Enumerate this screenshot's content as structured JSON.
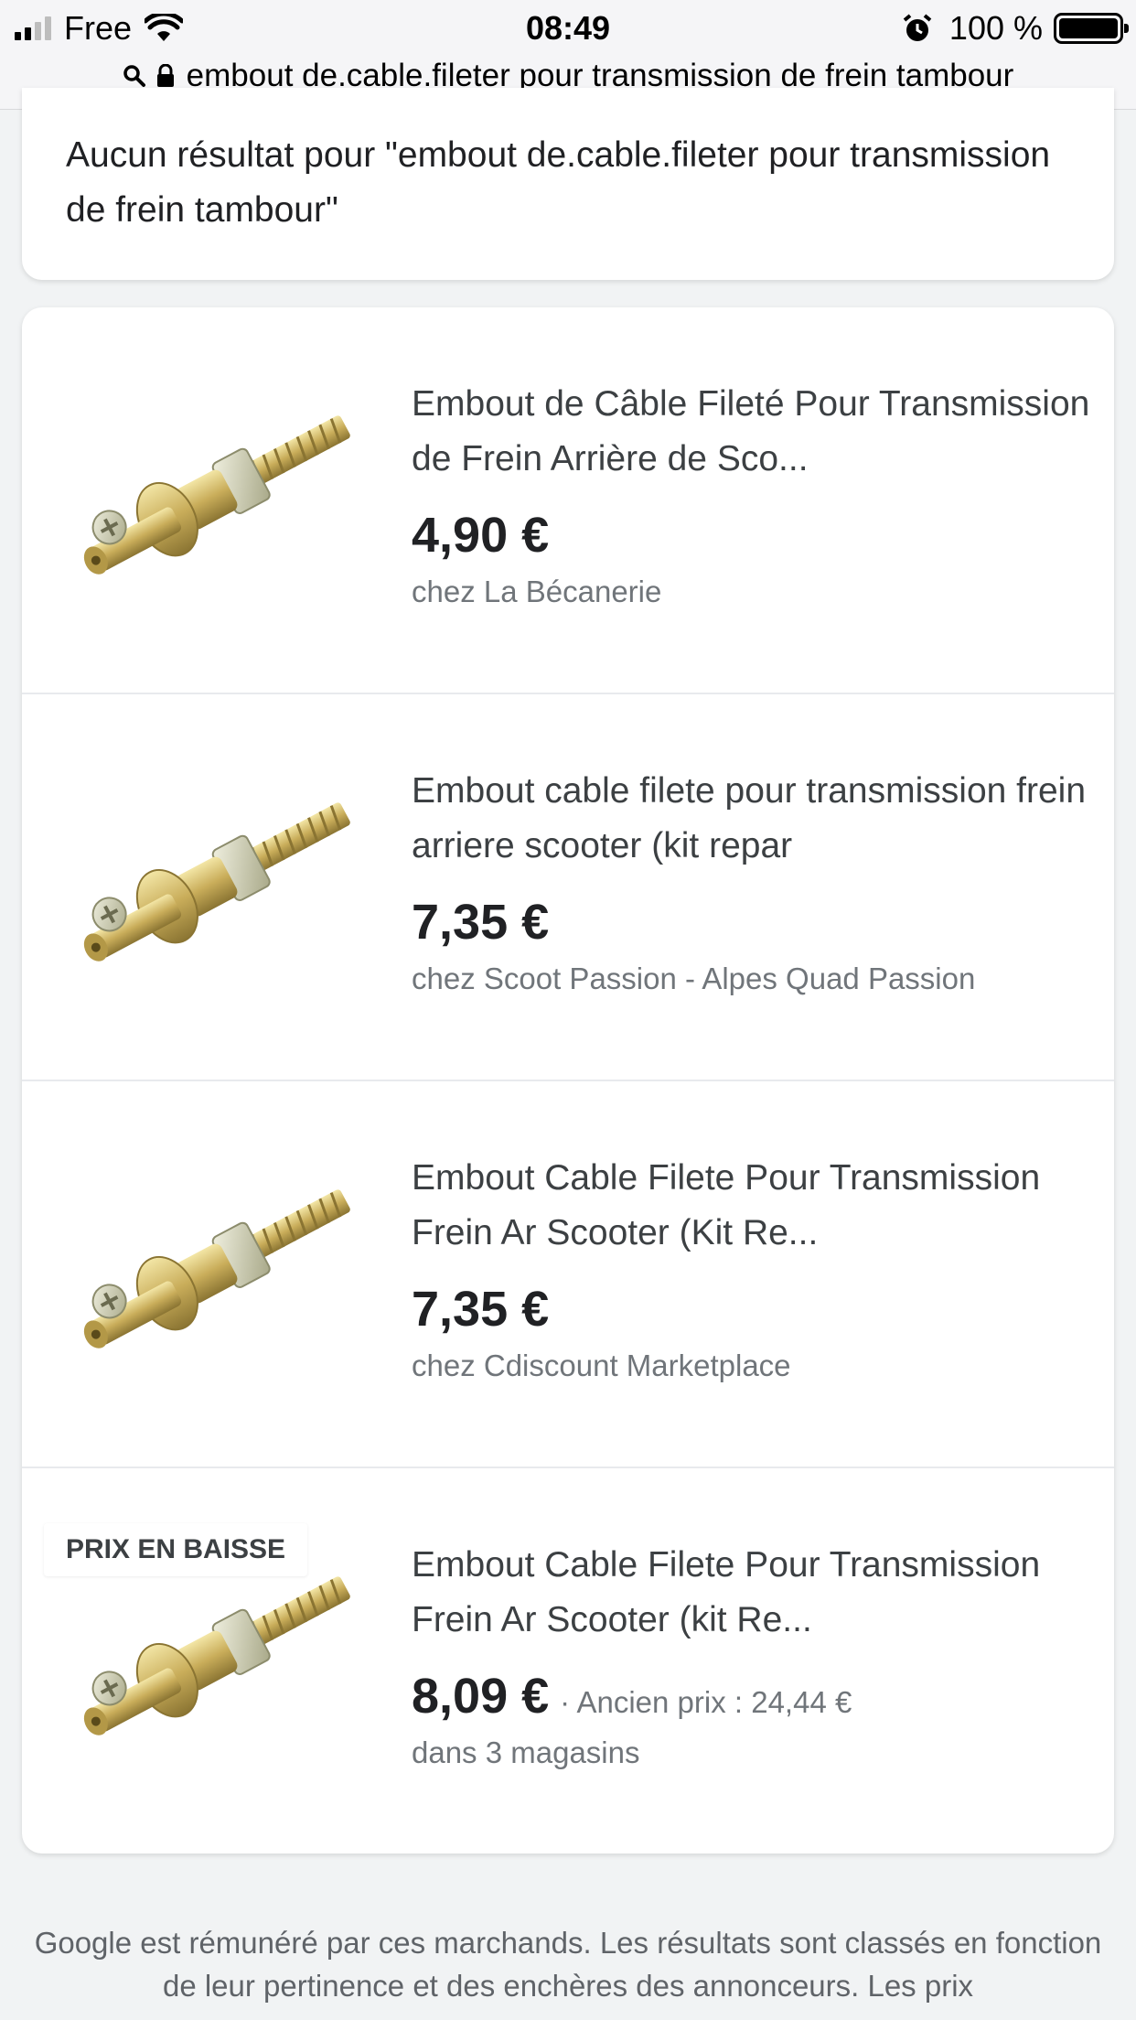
{
  "status_bar": {
    "carrier": "Free",
    "time": "08:49",
    "battery": "100 %"
  },
  "url_bar": {
    "text": "embout de.cable.fileter pour transmission de frein tambour"
  },
  "no_result": {
    "text": "Aucun résultat pour \"embout de.cable.fileter pour transmission de frein tambour\""
  },
  "results": [
    {
      "title": "Embout de Câble Fileté Pour Transmission de Frein Arrière de Sco...",
      "price": "4,90 €",
      "seller": "chez La Bécanerie"
    },
    {
      "title": "Embout cable filete pour transmission frein arriere scooter (kit repar",
      "price": "7,35 €",
      "seller": "chez Scoot Passion - Alpes Quad Passion"
    },
    {
      "title": "Embout Cable Filete Pour Transmission Frein Ar Scooter (Kit Re...",
      "price": "7,35 €",
      "seller": "chez Cdiscount Marketplace"
    },
    {
      "badge": "PRIX EN BAISSE",
      "title": "Embout Cable Filete Pour Transmission Frein Ar Scooter (kit Re...",
      "price": "8,09 €",
      "old_price": "· Ancien prix : 24,44 €",
      "seller": "dans 3 magasins"
    }
  ],
  "footer": {
    "text": "Google est rémunéré par ces marchands. Les résultats sont classés en fonction de leur pertinence et des enchères des annonceurs. Les prix"
  }
}
